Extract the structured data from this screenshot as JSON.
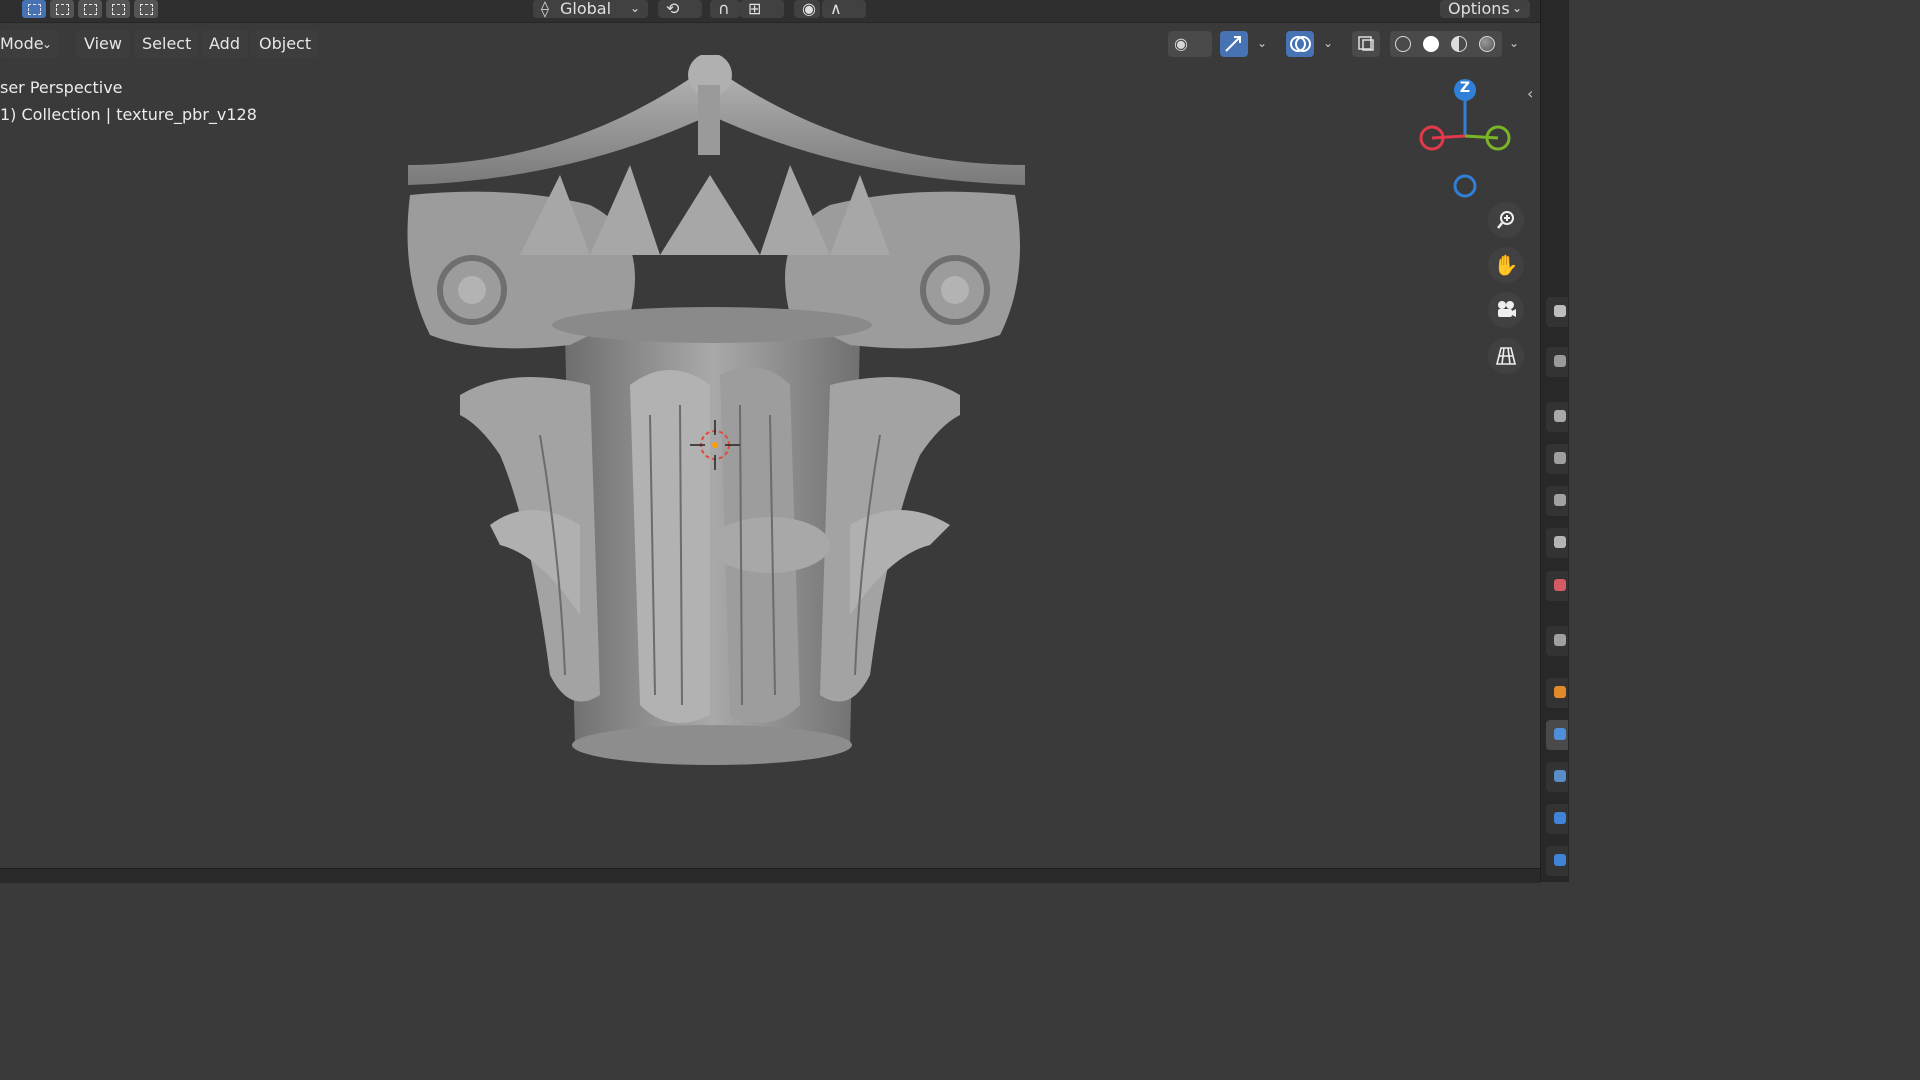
{
  "header": {
    "orientation_label": "Global",
    "options_label": "Options"
  },
  "menubar": {
    "mode": "Mode",
    "items": [
      "View",
      "Select",
      "Add",
      "Object"
    ]
  },
  "viewport": {
    "perspective_text": "ser Perspective",
    "collection_text": "1) Collection | texture_pbr_v128"
  },
  "gizmo": {
    "z_label": "Z",
    "colors": {
      "x": "#e2394a",
      "y": "#79b526",
      "z": "#2f80d6"
    }
  },
  "icons": [
    "zoom-icon",
    "pan-hand-icon",
    "camera-icon",
    "grid-icon",
    "eye-icon",
    "gizmo-icon",
    "overlay-icon",
    "xray-icon"
  ],
  "accent": "#4772b3"
}
